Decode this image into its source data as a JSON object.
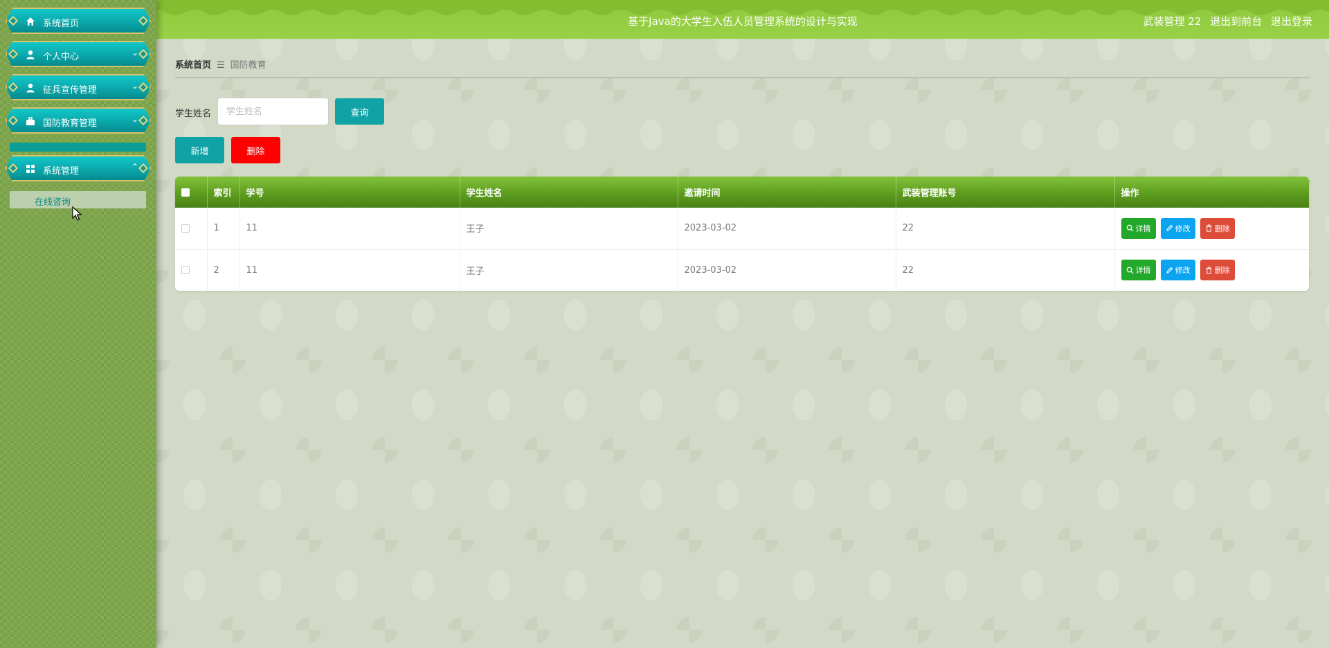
{
  "sidebar": {
    "items": [
      {
        "label": "系统首页",
        "icon": "home-icon"
      },
      {
        "label": "个人中心",
        "icon": "user-icon"
      },
      {
        "label": "征兵宣传管理",
        "icon": "user-icon"
      },
      {
        "label": "国防教育管理",
        "icon": "briefcase-icon"
      },
      {
        "label": "系统管理",
        "icon": "grid-icon"
      }
    ],
    "submenu": {
      "label": "在线咨询"
    }
  },
  "header": {
    "title": "基于Java的大学生入伍人员管理系统的设计与实现",
    "user": "武装管理 22",
    "to_front": "退出到前台",
    "logout": "退出登录"
  },
  "breadcrumb": {
    "home": "系统首页",
    "separator": "☰",
    "current": "国防教育"
  },
  "search": {
    "label": "学生姓名",
    "placeholder": "学生姓名",
    "button": "查询"
  },
  "actions": {
    "add": "新增",
    "delete": "删除"
  },
  "table": {
    "columns": [
      "索引",
      "学号",
      "学生姓名",
      "邀请时间",
      "武装管理账号",
      "操作"
    ],
    "rows": [
      {
        "index": "1",
        "student_no": "11",
        "student_name": "王子",
        "invite_time": "2023-03-02",
        "account": "22"
      },
      {
        "index": "2",
        "student_no": "11",
        "student_name": "王子",
        "invite_time": "2023-03-02",
        "account": "22"
      }
    ],
    "ops": {
      "detail": "详情",
      "edit": "修改",
      "delete": "删除"
    }
  },
  "colors": {
    "accent_teal": "#0fa3a6",
    "danger_red": "#fd0000",
    "header_green": "#8fc93b",
    "table_head_green": "#5d9d1e",
    "detail_green": "#22a82a",
    "edit_blue": "#0aa4f0",
    "delete_red": "#dd4b39"
  }
}
